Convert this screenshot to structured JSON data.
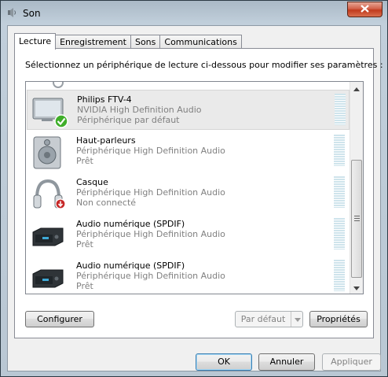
{
  "window": {
    "title": "Son"
  },
  "tabs": [
    {
      "label": "Lecture",
      "active": true
    },
    {
      "label": "Enregistrement",
      "active": false
    },
    {
      "label": "Sons",
      "active": false
    },
    {
      "label": "Communications",
      "active": false
    }
  ],
  "panel": {
    "instruction": "Sélectionnez un périphérique de lecture ci-dessous pour modifier ses paramètres :"
  },
  "devices": [
    {
      "name": "Philips FTV-4",
      "description": "NVIDIA High Definition Audio",
      "status": "Périphérique par défaut",
      "icon": "tv-monitor-icon",
      "badge": "default-check",
      "selected": true
    },
    {
      "name": "Haut-parleurs",
      "description": "Périphérique High Definition Audio",
      "status": "Prêt",
      "icon": "speaker-icon",
      "badge": null,
      "selected": false
    },
    {
      "name": "Casque",
      "description": "Périphérique High Definition Audio",
      "status": "Non connecté",
      "icon": "headphones-icon",
      "badge": "disconnected-arrow",
      "selected": false
    },
    {
      "name": "Audio numérique (SPDIF)",
      "description": "Périphérique High Definition Audio",
      "status": "Prêt",
      "icon": "digital-audio-device-icon",
      "badge": null,
      "selected": false
    },
    {
      "name": "Audio numérique (SPDIF)",
      "description": "Périphérique High Definition Audio",
      "status": "Prêt",
      "icon": "digital-audio-device-icon",
      "badge": null,
      "selected": false
    }
  ],
  "buttons": {
    "configure": "Configurer",
    "set_default": "Par défaut",
    "properties": "Propriétés",
    "ok": "OK",
    "cancel": "Annuler",
    "apply": "Appliquer"
  },
  "colors": {
    "check_badge": "#3fae2a",
    "disconnected_badge": "#c62828",
    "meter": "#cfe4ec"
  }
}
